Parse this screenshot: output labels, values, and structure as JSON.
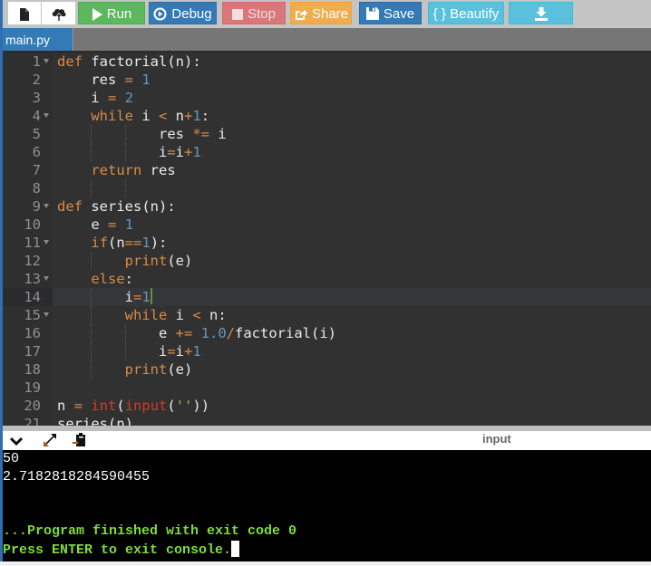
{
  "toolbar": {
    "new_file": {
      "icon": "new-file-icon"
    },
    "upload": {
      "icon": "upload-cloud-icon"
    },
    "run": {
      "label": "Run",
      "icon": "play-icon",
      "color": "#5cb85c"
    },
    "debug": {
      "label": "Debug",
      "icon": "debug-circle-icon",
      "color": "#337ab7"
    },
    "stop": {
      "label": "Stop",
      "icon": "stop-square-icon",
      "color": "#d9777a"
    },
    "share": {
      "label": "Share",
      "icon": "share-icon",
      "color": "#f0ad4e"
    },
    "save": {
      "label": "Save",
      "icon": "floppy-disk-icon",
      "color": "#337ab7"
    },
    "beautify": {
      "label": "{ } Beautify",
      "color": "#5bc0de"
    },
    "download": {
      "icon": "download-icon",
      "color": "#5bc0de"
    }
  },
  "tabs": [
    {
      "label": "main.py",
      "active": true
    }
  ],
  "editor": {
    "active_line": 14,
    "lines": [
      {
        "n": "1",
        "fold": true,
        "text": "def factorial(n):"
      },
      {
        "n": "2",
        "fold": false,
        "text": "    res = 1"
      },
      {
        "n": "3",
        "fold": false,
        "text": "    i = 2"
      },
      {
        "n": "4",
        "fold": true,
        "text": "    while i < n+1:"
      },
      {
        "n": "5",
        "fold": false,
        "text": "            res *= i"
      },
      {
        "n": "6",
        "fold": false,
        "text": "            i=i+1"
      },
      {
        "n": "7",
        "fold": false,
        "text": "    return res"
      },
      {
        "n": "8",
        "fold": false,
        "text": ""
      },
      {
        "n": "9",
        "fold": true,
        "text": "def series(n):"
      },
      {
        "n": "10",
        "fold": false,
        "text": "    e = 1"
      },
      {
        "n": "11",
        "fold": true,
        "text": "    if(n==1):"
      },
      {
        "n": "12",
        "fold": false,
        "text": "        print(e)"
      },
      {
        "n": "13",
        "fold": true,
        "text": "    else:"
      },
      {
        "n": "14",
        "fold": false,
        "text": "        i=1"
      },
      {
        "n": "15",
        "fold": true,
        "text": "        while i < n:"
      },
      {
        "n": "16",
        "fold": false,
        "text": "            e += 1.0/factorial(i)"
      },
      {
        "n": "17",
        "fold": false,
        "text": "            i=i+1"
      },
      {
        "n": "18",
        "fold": false,
        "text": "        print(e)"
      },
      {
        "n": "19",
        "fold": false,
        "text": ""
      },
      {
        "n": "20",
        "fold": false,
        "text": "n = int(input(''))"
      },
      {
        "n": "21",
        "fold": false,
        "text": "series(n)"
      }
    ]
  },
  "console_header": {
    "collapse_icon": "chevron-down-icon",
    "expand_icon": "expand-arrows-icon",
    "clipboard_icon": "paste-clipboard-icon",
    "input_label": "input"
  },
  "console": {
    "lines": [
      {
        "text": "50",
        "style": "white"
      },
      {
        "text": "2.7182818284590455",
        "style": "white"
      },
      {
        "text": "",
        "style": "white"
      },
      {
        "text": "",
        "style": "white"
      },
      {
        "text": "...Program finished with exit code 0",
        "style": "green"
      },
      {
        "text": "Press ENTER to exit console.",
        "style": "green"
      }
    ]
  },
  "colors": {
    "keyword": "#d98b46",
    "number": "#6897bb",
    "builtin": "#cc3d2f",
    "string": "#8fbf5a",
    "console_green": "#7ddc3a"
  }
}
